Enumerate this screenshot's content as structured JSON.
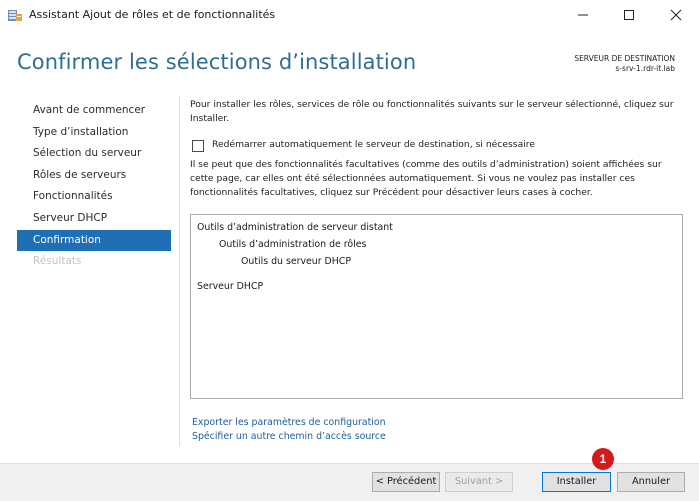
{
  "window": {
    "title": "Assistant Ajout de rôles et de fonctionnalités",
    "icon": "server-manager-icon"
  },
  "header": {
    "page_title": "Confirmer les sélections d’installation",
    "dest_label": "SERVEUR DE DESTINATION",
    "dest_server": "s-srv-1.rdr-it.lab"
  },
  "nav": {
    "items": [
      {
        "label": "Avant de commencer",
        "state": "normal"
      },
      {
        "label": "Type d’installation",
        "state": "normal"
      },
      {
        "label": "Sélection du serveur",
        "state": "normal"
      },
      {
        "label": "Rôles de serveurs",
        "state": "normal"
      },
      {
        "label": "Fonctionnalités",
        "state": "normal"
      },
      {
        "label": "Serveur DHCP",
        "state": "normal"
      },
      {
        "label": "Confirmation",
        "state": "active"
      },
      {
        "label": "Résultats",
        "state": "disabled"
      }
    ]
  },
  "content": {
    "intro": "Pour installer les rôles, services de rôle ou fonctionnalités suivants sur le serveur sélectionné, cliquez sur Installer.",
    "restart_label": "Redémarrer automatiquement le serveur de destination, si nécessaire",
    "restart_checked": false,
    "note": "Il se peut que des fonctionnalités facultatives (comme des outils d’administration) soient affichées sur cette page, car elles ont été sélectionnées automatiquement. Si vous ne voulez pas installer ces fonctionnalités facultatives, cliquez sur Précédent pour désactiver leurs cases à cocher.",
    "tree": [
      {
        "label": "Outils d’administration de serveur distant",
        "level": 0
      },
      {
        "label": "Outils d’administration de rôles",
        "level": 1
      },
      {
        "label": "Outils du serveur DHCP",
        "level": 2
      },
      {
        "label": "Serveur DHCP",
        "level": 0
      }
    ],
    "links": {
      "export": "Exporter les paramètres de configuration",
      "alt_source": "Spécifier un autre chemin d’accès source"
    }
  },
  "footer": {
    "previous": "< Précédent",
    "next": "Suivant >",
    "install": "Installer",
    "cancel": "Annuler"
  },
  "annotation": {
    "step_number": "1",
    "color": "#d21c1c"
  },
  "colors": {
    "accent": "#1f6fb6",
    "title": "#2f6e8e",
    "link": "#1f5e9c"
  }
}
